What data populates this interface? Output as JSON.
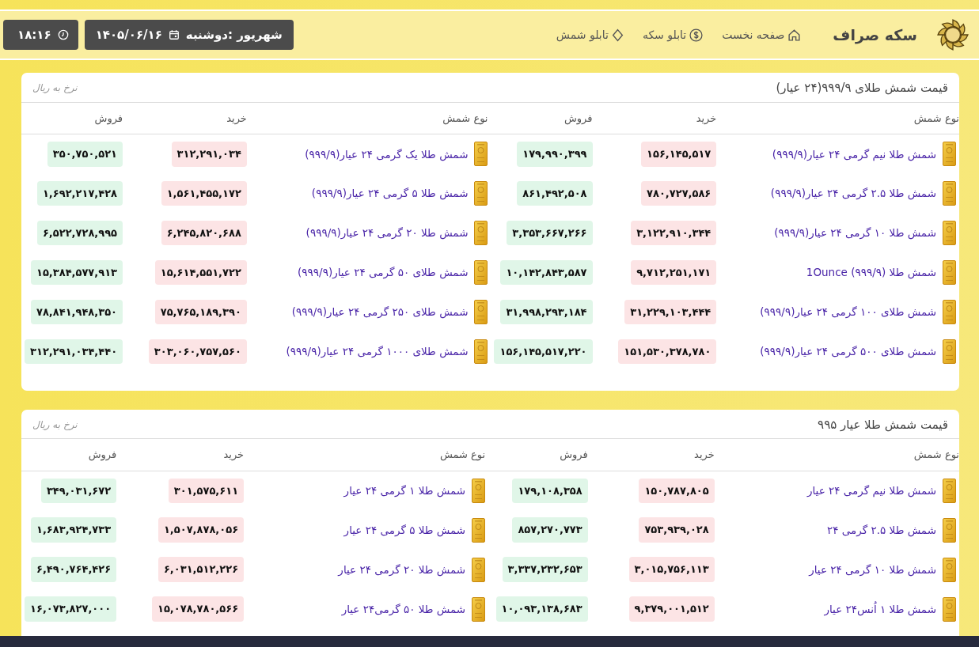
{
  "header": {
    "brand": "سکه صراف",
    "nav": [
      {
        "label": "صفحه نخست"
      },
      {
        "label": "تابلو سکه"
      },
      {
        "label": "تابلو شمش"
      }
    ],
    "date": {
      "day": "شهریور :دوشنبه",
      "value": "۱۴۰۵/۰۶/۱۶"
    },
    "time": "۱۸:۱۶"
  },
  "sections": [
    {
      "title": "قیمت شمش طلای ۹۹۹/۹(۲۴ عیار)",
      "note": "نرخ به ریال",
      "columns": [
        "نوع شمش",
        "خرید",
        "فروش",
        "نوع شمش",
        "خرید",
        "فروش"
      ],
      "rows": [
        {
          "items": [
            {
              "name": "شمش طلا نیم گرمی ۲۴ عیار(۹۹۹/۹)",
              "buy": "۱۵۶,۱۴۵,۵۱۷",
              "sell": "۱۷۹,۹۹۰,۳۹۹"
            },
            {
              "name": "شمش طلا یک گرمی ۲۴ عیار(۹۹۹/۹)",
              "buy": "۳۱۲,۲۹۱,۰۳۴",
              "sell": "۳۵۰,۷۵۰,۵۲۱"
            }
          ]
        },
        {
          "items": [
            {
              "name": "شمش طلا ۲.۵ گرمی ۲۴ عیار(۹۹۹/۹)",
              "buy": "۷۸۰,۷۲۷,۵۸۶",
              "sell": "۸۶۱,۴۹۲,۵۰۸"
            },
            {
              "name": "شمش طلا ۵ گرمی ۲۴ عیار(۹۹۹/۹)",
              "buy": "۱,۵۶۱,۴۵۵,۱۷۲",
              "sell": "۱,۶۹۲,۲۱۷,۴۲۸"
            }
          ]
        },
        {
          "items": [
            {
              "name": "شمش طلا ۱۰ گرمی ۲۴ عیار(۹۹۹/۹)",
              "buy": "۳,۱۲۲,۹۱۰,۳۴۴",
              "sell": "۳,۳۵۳,۶۶۷,۲۶۶"
            },
            {
              "name": "شمش طلا ۲۰ گرمی ۲۴ عیار(۹۹۹/۹)",
              "buy": "۶,۲۴۵,۸۲۰,۶۸۸",
              "sell": "۶,۵۲۲,۷۲۸,۹۹۵"
            }
          ]
        },
        {
          "items": [
            {
              "name": "شمش طلا (۹۹۹/۹) 1Ounce",
              "buy": "۹,۷۱۲,۲۵۱,۱۷۱",
              "sell": "۱۰,۱۴۲,۸۴۳,۵۸۷"
            },
            {
              "name": "شمش طلای ۵۰ گرمی ۲۴ عیار(۹۹۹/۹)",
              "buy": "۱۵,۶۱۴,۵۵۱,۷۲۲",
              "sell": "۱۵,۳۸۴,۵۷۷,۹۱۳"
            }
          ]
        },
        {
          "items": [
            {
              "name": "شمش طلای ۱۰۰ گرمی ۲۴ عیار(۹۹۹/۹)",
              "buy": "۳۱,۲۲۹,۱۰۳,۴۴۴",
              "sell": "۳۱,۹۹۸,۲۹۳,۱۸۴"
            },
            {
              "name": "شمش طلای ۲۵۰ گرمی ۲۴ عیار(۹۹۹/۹)",
              "buy": "۷۵,۷۶۵,۱۸۹,۳۹۰",
              "sell": "۷۸,۸۴۱,۹۴۸,۳۵۰"
            }
          ]
        },
        {
          "items": [
            {
              "name": "شمش طلای ۵۰۰ گرمی ۲۴ عیار(۹۹۹/۹)",
              "buy": "۱۵۱,۵۳۰,۳۷۸,۷۸۰",
              "sell": "۱۵۶,۱۴۵,۵۱۷,۲۲۰"
            },
            {
              "name": "شمش طلای ۱۰۰۰ گرمی ۲۴ عیار(۹۹۹/۹)",
              "buy": "۳۰۳,۰۶۰,۷۵۷,۵۶۰",
              "sell": "۳۱۲,۲۹۱,۰۳۴,۴۴۰"
            }
          ]
        }
      ]
    },
    {
      "title": "قیمت شمش طلا عیار ۹۹۵",
      "note": "نرخ به ریال",
      "columns": [
        "نوع شمش",
        "خرید",
        "فروش",
        "نوع شمش",
        "خرید",
        "فروش"
      ],
      "rows": [
        {
          "items": [
            {
              "name": "شمش طلا نیم گرمی ۲۴ عیار",
              "buy": "۱۵۰,۷۸۷,۸۰۵",
              "sell": "۱۷۹,۱۰۸,۳۵۸"
            },
            {
              "name": "شمش طلا ۱ گرمی ۲۴ عیار",
              "buy": "۳۰۱,۵۷۵,۶۱۱",
              "sell": "۳۴۹,۰۳۱,۶۷۲"
            }
          ]
        },
        {
          "items": [
            {
              "name": "شمش طلا ۲.۵ گرمی ۲۴",
              "buy": "۷۵۳,۹۳۹,۰۲۸",
              "sell": "۸۵۷,۲۷۰,۷۷۳"
            },
            {
              "name": "شمش طلا ۵ گرمی ۲۴ عیار",
              "buy": "۱,۵۰۷,۸۷۸,۰۵۶",
              "sell": "۱,۶۸۳,۹۲۴,۷۳۳"
            }
          ]
        },
        {
          "items": [
            {
              "name": "شمش طلا ۱۰ گرمی ۲۴ عیار",
              "buy": "۳,۰۱۵,۷۵۶,۱۱۳",
              "sell": "۳,۳۳۷,۲۳۲,۶۵۳"
            },
            {
              "name": "شمش طلا ۲۰ گرمی ۲۴ عیار",
              "buy": "۶,۰۳۱,۵۱۲,۲۲۶",
              "sell": "۶,۴۹۰,۷۶۴,۴۲۶"
            }
          ]
        },
        {
          "items": [
            {
              "name": "شمش طلا ۱ اُنس۲۴ عیار",
              "buy": "۹,۳۷۹,۰۰۱,۵۱۲",
              "sell": "۱۰,۰۹۳,۱۳۸,۶۸۳"
            },
            {
              "name": "شمش طلا ۵۰ گرمی۲۴ عیار",
              "buy": "۱۵,۰۷۸,۷۸۰,۵۶۶",
              "sell": "۱۶,۰۷۳,۸۲۷,۰۰۰"
            }
          ]
        }
      ]
    }
  ]
}
